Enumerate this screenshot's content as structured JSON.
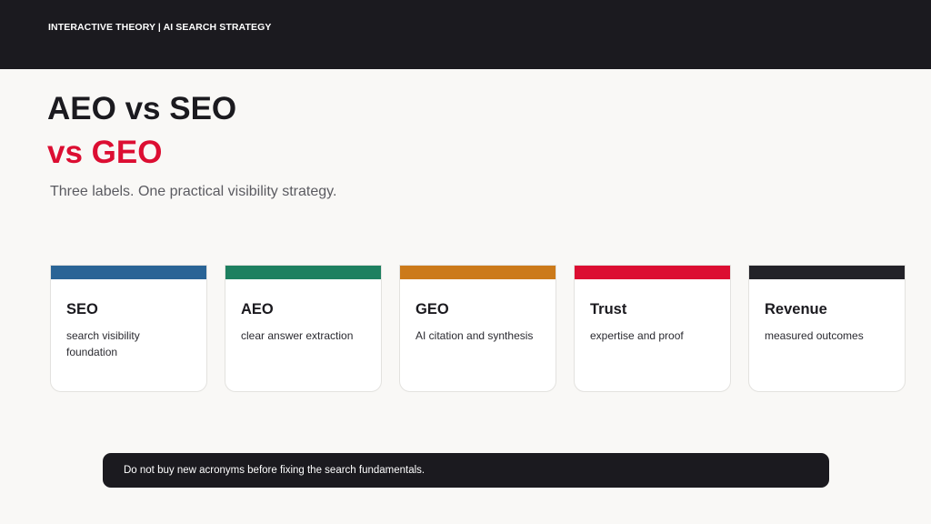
{
  "header": {
    "label": "INTERACTIVE THEORY | AI SEARCH STRATEGY"
  },
  "title": {
    "line1": "AEO vs SEO",
    "line2": "vs GEO",
    "line2_color": "#dc0e32"
  },
  "subtitle": "Three labels. One practical visibility strategy.",
  "cards": [
    {
      "title": "SEO",
      "description": "search visibility foundation",
      "color": "#2a6496"
    },
    {
      "title": "AEO",
      "description": "clear answer extraction",
      "color": "#1e8060"
    },
    {
      "title": "GEO",
      "description": "AI citation and synthesis",
      "color": "#cc7a1a"
    },
    {
      "title": "Trust",
      "description": "expertise and proof",
      "color": "#dc0e32"
    },
    {
      "title": "Revenue",
      "description": "measured outcomes",
      "color": "#232228"
    }
  ],
  "callout": {
    "text": "Do not buy new acronyms before fixing the search fundamentals."
  }
}
